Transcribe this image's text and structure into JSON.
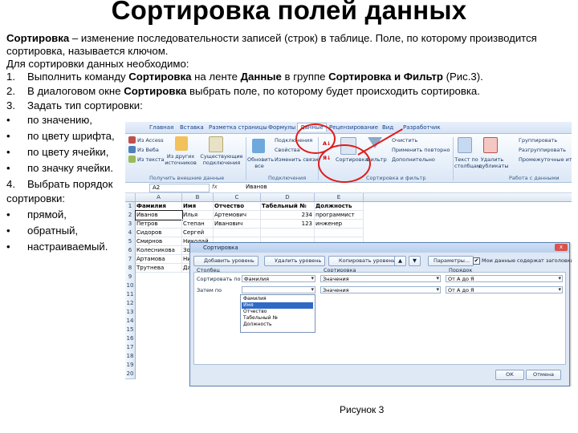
{
  "title": "Сортировка полей данных",
  "intro": {
    "bold": "Сортировка",
    "rest": " – изменение последовательности записей (строк) в таблице. Поле, по которому производится сортировка, называется ключом."
  },
  "need": "Для сортировки данных необходимо:",
  "step1": {
    "num": "1.",
    "a": "Выполнить команду ",
    "b1": "Сортировка",
    "c": " на ленте ",
    "b2": "Данные",
    "d": " в группе ",
    "b3": "Сортировка и Фильтр",
    "e": " (Рис.3)."
  },
  "step2": {
    "num": "2.",
    "a": "В диалоговом окне ",
    "b": "Сортировка",
    "c": " выбрать поле, по которому будет происходить сортировка."
  },
  "step3": {
    "num": "3.",
    "text": "Задать тип сортировки:"
  },
  "types": [
    "по значению,",
    "по цвету шрифта,",
    "по цвету ячейки,",
    "по значку ячейки."
  ],
  "step4": {
    "num": "4.",
    "text": "Выбрать порядок",
    "text2": "сортировки:"
  },
  "orders": [
    "прямой,",
    "обратный,",
    "настраиваемый."
  ],
  "bullet": "•",
  "excel": {
    "tabs": [
      "Главная",
      "Вставка",
      "Разметка страницы",
      "Формулы",
      "Данные",
      "Рецензирование",
      "Вид",
      "Разработчик"
    ],
    "ribbon": {
      "ext1": "Из Access",
      "ext2": "Из Веба",
      "ext3": "Из текста",
      "other": "Из других источников",
      "existing": "Существующие подключения",
      "refresh": "Обновить все",
      "conn1": "Подключения",
      "conn2": "Свойства",
      "conn3": "Изменить связи",
      "sort": "Сортировка",
      "filter": "Фильтр",
      "clear": "Очистить",
      "reapply": "Применить повторно",
      "advanced": "Дополнительно",
      "text_cols": "Текст по столбцам",
      "remove_dup": "Удалить дубликаты",
      "group": "Группировать",
      "ungroup": "Разгруппировать",
      "subtotal": "Промежуточные итоги",
      "grp_external": "Получить внешние данные",
      "grp_conn": "Подключения",
      "grp_sort": "Сортировка и фильтр",
      "grp_struct": "Работа с данными"
    },
    "namebox": "A2",
    "fx": "fx",
    "formula": "Иванов",
    "columns": [
      "A",
      "B",
      "C",
      "D",
      "E"
    ],
    "rows": [
      "1",
      "2",
      "3",
      "4",
      "5",
      "6",
      "7",
      "8",
      "9",
      "10",
      "11",
      "12",
      "13",
      "14",
      "15",
      "16",
      "17",
      "18",
      "19",
      "20"
    ],
    "headers": [
      "Фамилия",
      "Имя",
      "Отчество",
      "Табельный №",
      "Должность"
    ],
    "data": [
      [
        "Иванов",
        "Илья",
        "Артемович",
        "234",
        "программист"
      ],
      [
        "Петров",
        "Степан",
        "Иванович",
        "123",
        "инженер"
      ],
      [
        "Сидоров",
        "Сергей",
        "",
        "",
        ""
      ],
      [
        "Смирнов",
        "Николай",
        "",
        "",
        ""
      ],
      [
        "Колесникова",
        "Зоя",
        "",
        "",
        ""
      ],
      [
        "Артамова",
        "Нина",
        "",
        "",
        ""
      ],
      [
        "Трутнева",
        "Дарья",
        "",
        "",
        ""
      ]
    ]
  },
  "dialog": {
    "title": "Сортировка",
    "close": "x",
    "btn_add": "Добавить уровень",
    "btn_del": "Удалить уровень",
    "btn_copy": "Копировать уровень",
    "btn_params": "Параметры...",
    "check_mark": "✔",
    "header_check": "Мои данные содержат заголовки",
    "col_column": "Столбец",
    "col_sort": "Сортировка",
    "col_order": "Порядок",
    "sort_by": "Сортировать по",
    "then_by": "Затем по",
    "row1": {
      "field": "Фамилия",
      "sort": "Значения",
      "order": "От А до Я"
    },
    "row2": {
      "field": "",
      "sort": "Значения",
      "order": "От А до Я"
    },
    "list": [
      "Фамилия",
      "Имя",
      "Отчество",
      "Табельный №",
      "Должность"
    ],
    "ok": "ОК",
    "cancel": "Отмена"
  },
  "caption": "Рисунок 3"
}
